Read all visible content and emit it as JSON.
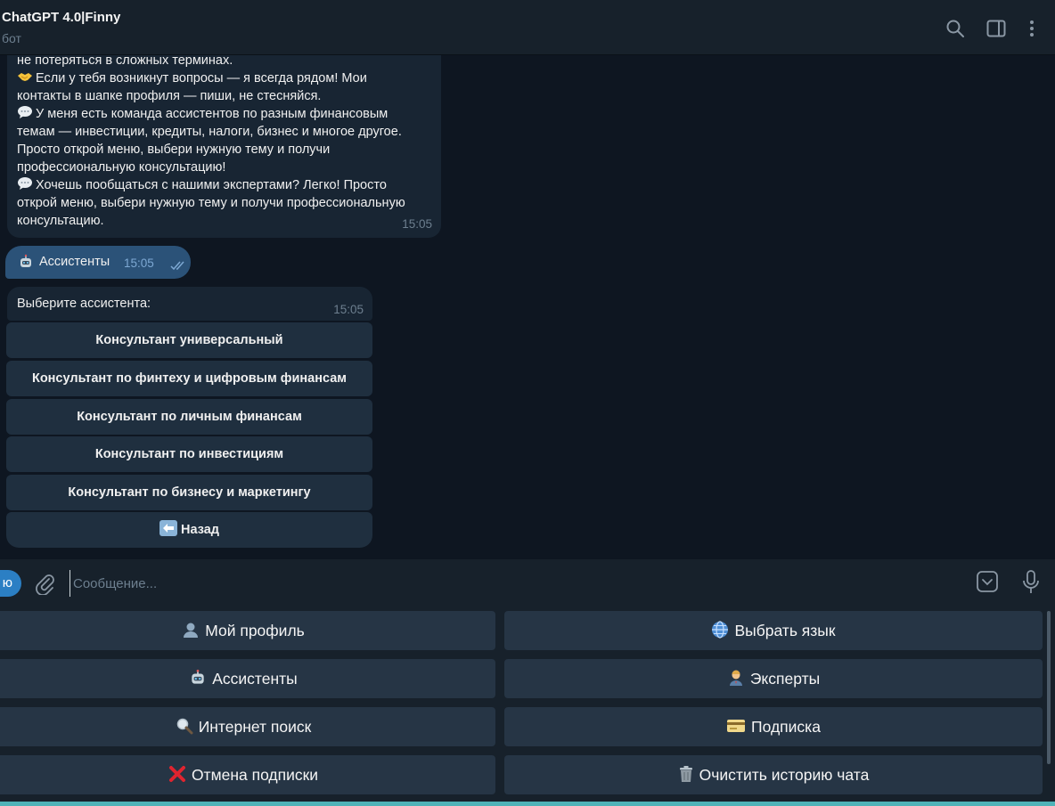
{
  "header": {
    "title": "ChatGPT 4.0|Finny",
    "subtitle": "бот"
  },
  "messages": {
    "bot_intro": {
      "lines": [
        "не потеряться в сложных терминах.",
        "Если у тебя возникнут вопросы — я всегда рядом! Мои",
        "контакты в шапке профиля — пиши, не стесняйся.",
        "У меня есть команда ассистентов по разным финансовым",
        "темам — инвестиции, кредиты, налоги, бизнес и многое другое.",
        "Просто открой меню, выбери нужную тему и получи",
        "профессиональную консультацию!",
        "Хочешь пообщаться с нашими экспертами? Легко! Просто",
        "открой меню, выбери нужную тему и получи профессиональную",
        "консультацию."
      ],
      "time": "15:05"
    },
    "user_msg": {
      "text": "Ассистенты",
      "time": "15:05"
    },
    "bot_choose": {
      "text": "Выберите ассистента:",
      "time": "15:05",
      "buttons": [
        "Консультант универсальный",
        "Консультант по финтеху и цифровым финансам",
        "Консультант по личным финансам",
        "Консультант по инвестициям",
        "Консультант по бизнесу и маркетингу",
        "Назад"
      ]
    }
  },
  "composer": {
    "menu_label": "ю",
    "placeholder": "Сообщение..."
  },
  "reply_keyboard": {
    "buttons": [
      {
        "label": "Мой профиль",
        "icon": "bust-icon"
      },
      {
        "label": "Выбрать язык",
        "icon": "globe-icon"
      },
      {
        "label": "Ассистенты",
        "icon": "robot-icon"
      },
      {
        "label": "Эксперты",
        "icon": "person-icon"
      },
      {
        "label": "Интернет поиск",
        "icon": "magnifier-icon"
      },
      {
        "label": "Подписка",
        "icon": "credit-card-icon"
      },
      {
        "label": "Отмена подписки",
        "icon": "red-x-icon"
      },
      {
        "label": "Очистить историю чата",
        "icon": "trash-icon"
      }
    ]
  },
  "colors": {
    "background": "#0e1621",
    "header": "#17212b",
    "incoming_bubble": "#182533",
    "outgoing_bubble": "#2b5278",
    "accent": "#2b7fc4"
  }
}
